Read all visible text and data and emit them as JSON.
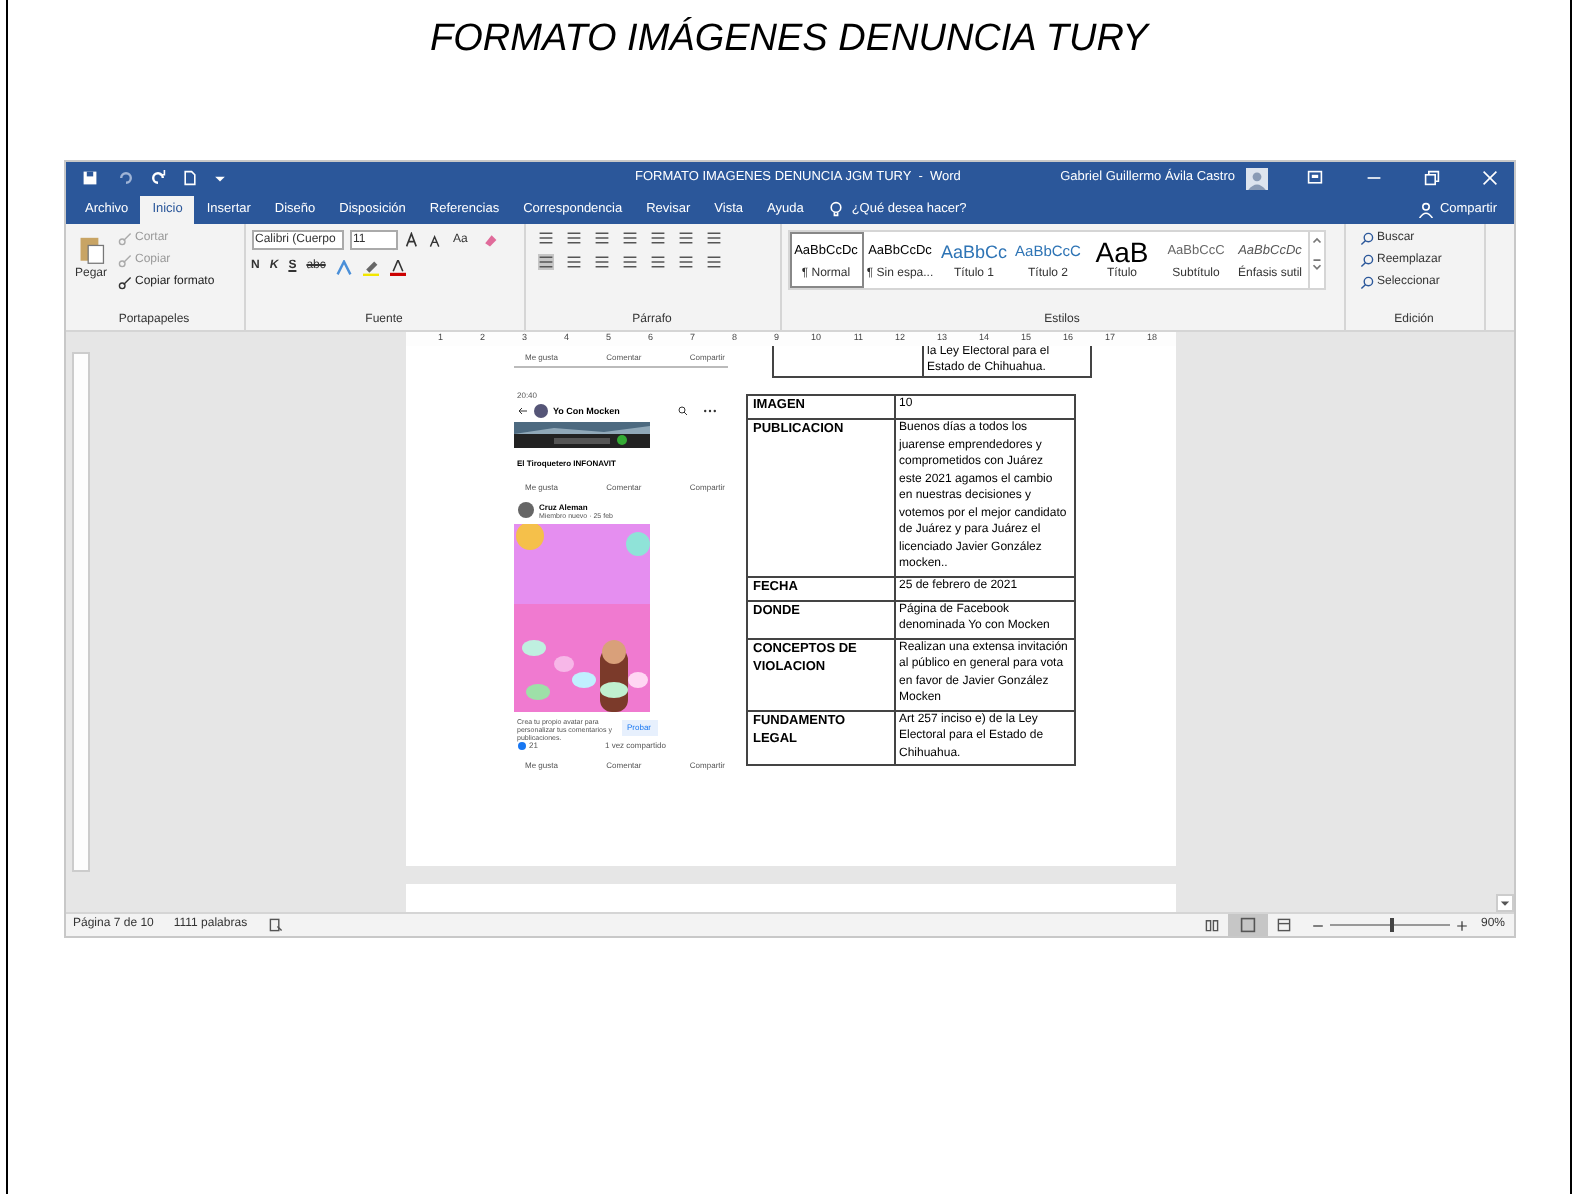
{
  "document_title": "FORMATO IMÁGENES DENUNCIA TURY",
  "word": {
    "title_bar": {
      "title": "FORMATO IMAGENES DENUNCIA JGM TURY  -  Word",
      "user": "Gabriel Guillermo Ávila Castro"
    },
    "tabs": [
      {
        "label": "Archivo",
        "selected": false
      },
      {
        "label": "Inicio",
        "selected": true
      },
      {
        "label": "Insertar",
        "selected": false
      },
      {
        "label": "Diseño",
        "selected": false
      },
      {
        "label": "Disposición",
        "selected": false
      },
      {
        "label": "Referencias",
        "selected": false
      },
      {
        "label": "Correspondencia",
        "selected": false
      },
      {
        "label": "Revisar",
        "selected": false
      },
      {
        "label": "Vista",
        "selected": false
      },
      {
        "label": "Ayuda",
        "selected": false
      }
    ],
    "tell_me": "¿Qué desea hacer?",
    "share": "Compartir",
    "clipboard": {
      "paste": "Pegar",
      "cut": "Cortar",
      "copy": "Copiar",
      "format_painter": "Copiar formato",
      "label": "Portapapeles"
    },
    "font": {
      "name": "Calibri (Cuerpo",
      "size": "11",
      "case": "Aa",
      "bold": "N",
      "italic": "K",
      "underline": "S",
      "strike": "abc",
      "label": "Fuente"
    },
    "paragraph": {
      "label": "Párrafo"
    },
    "styles": {
      "label": "Estilos",
      "items": [
        {
          "preview": "AaBbCcDc",
          "name": "¶ Normal",
          "selected": true
        },
        {
          "preview": "AaBbCcDc",
          "name": "¶ Sin espa...",
          "selected": false
        },
        {
          "preview": "AaBbCc",
          "name": "Título 1",
          "selected": false
        },
        {
          "preview": "AaBbCcC",
          "name": "Título 2",
          "selected": false
        },
        {
          "preview": "AaB",
          "name": "Título",
          "selected": false
        },
        {
          "preview": "AaBbCcC",
          "name": "Subtítulo",
          "selected": false
        },
        {
          "preview": "AaBbCcDc",
          "name": "Énfasis sutil",
          "selected": false
        }
      ]
    },
    "editing": {
      "label": "Edición",
      "find": "Buscar",
      "replace": "Reemplazar",
      "select": "Seleccionar"
    },
    "ruler": [
      "1",
      "2",
      "3",
      "4",
      "5",
      "6",
      "7",
      "8",
      "9",
      "10",
      "11",
      "12",
      "13",
      "14",
      "15",
      "16",
      "17",
      "18"
    ],
    "page": {
      "previous_table_tail": "la Ley Electoral para el Estado de Chihuahua.",
      "post": {
        "top_actions": [
          "Me gusta",
          "Comentar",
          "Compartir"
        ],
        "link_actions": [
          "Me gusta",
          "Comentar",
          "Compartir"
        ],
        "bottom_actions": [
          "Me gusta",
          "Comentar",
          "Compartir"
        ],
        "time": "20:40",
        "group": "Yo Con Mocken",
        "link_title": "El Tiroquetero INFONAVIT",
        "author": "Cruz Aleman",
        "author_meta": "Miembro nuevo · 25 feb",
        "avatar_prompt": "Crea tu propio avatar para personalizar tus comentarios y publicaciones.",
        "try_button": "Probar",
        "reactions": "21",
        "shares": "1 vez compartido"
      },
      "table": [
        {
          "label": "IMAGEN",
          "value": "10"
        },
        {
          "label": "PUBLICACION",
          "value": "Buenos días a todos los juarense emprendedores y comprometidos con Juárez este 2021 agamos el cambio en nuestras decisiones y votemos por el mejor candidato de Juárez y para Juárez el licenciado Javier González mocken.."
        },
        {
          "label": "FECHA",
          "value": "25 de febrero de 2021"
        },
        {
          "label": "DONDE",
          "value": "Página de Facebook denominada Yo con Mocken"
        },
        {
          "label": "CONCEPTOS DE VIOLACION",
          "value": "Realizan una extensa invitación al público en general para vota en favor de Javier González Mocken"
        },
        {
          "label": "FUNDAMENTO LEGAL",
          "value": "Art 257 inciso e) de la Ley Electoral para el Estado de Chihuahua."
        }
      ]
    },
    "status_bar": {
      "page": "Página 7 de 10",
      "words": "1111 palabras",
      "zoom": "90%",
      "zoom_slider": {
        "level": 0.5
      }
    }
  }
}
